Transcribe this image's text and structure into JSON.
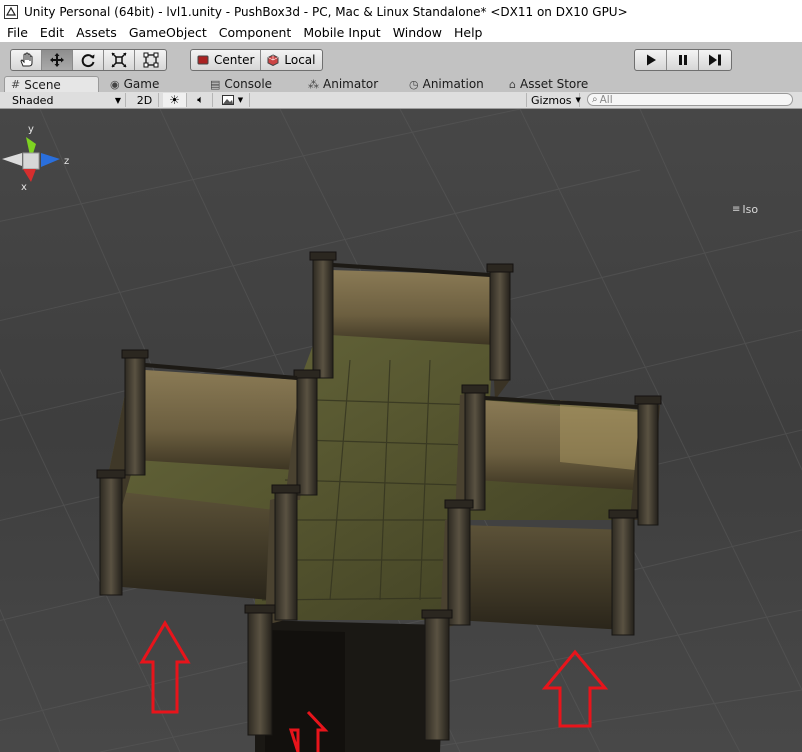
{
  "window": {
    "title": "Unity Personal (64bit) - lvl1.unity - PushBox3d - PC, Mac & Linux Standalone* <DX11 on DX10 GPU>"
  },
  "menu": [
    "File",
    "Edit",
    "Assets",
    "GameObject",
    "Component",
    "Mobile Input",
    "Window",
    "Help"
  ],
  "toolbar": {
    "tools": [
      "hand-tool",
      "move-tool",
      "rotate-tool",
      "scale-tool",
      "rect-tool"
    ],
    "active_tool": "move-tool",
    "pivot_label": "Center",
    "space_label": "Local"
  },
  "tabs": [
    {
      "label": "Scene",
      "icon": "scene-icon",
      "active": true
    },
    {
      "label": "Game",
      "icon": "game-icon",
      "active": false
    },
    {
      "label": "Console",
      "icon": "console-icon",
      "active": false
    },
    {
      "label": "Animator",
      "icon": "animator-icon",
      "active": false
    },
    {
      "label": "Animation",
      "icon": "animation-icon",
      "active": false
    },
    {
      "label": "Asset Store",
      "icon": "asset-store-icon",
      "active": false
    }
  ],
  "scene_toolbar": {
    "draw_mode": "Shaded",
    "mode_2d": "2D",
    "gizmos_label": "Gizmos",
    "search_placeholder": "All"
  },
  "gizmo": {
    "axis_y": "y",
    "axis_z": "z",
    "axis_x": "x",
    "projection": "Iso"
  },
  "colors": {
    "toolbar_bg": "#c2c2c2",
    "viewport_bg": "#4a4a4a",
    "annotation_arrow": "#e8141b"
  }
}
